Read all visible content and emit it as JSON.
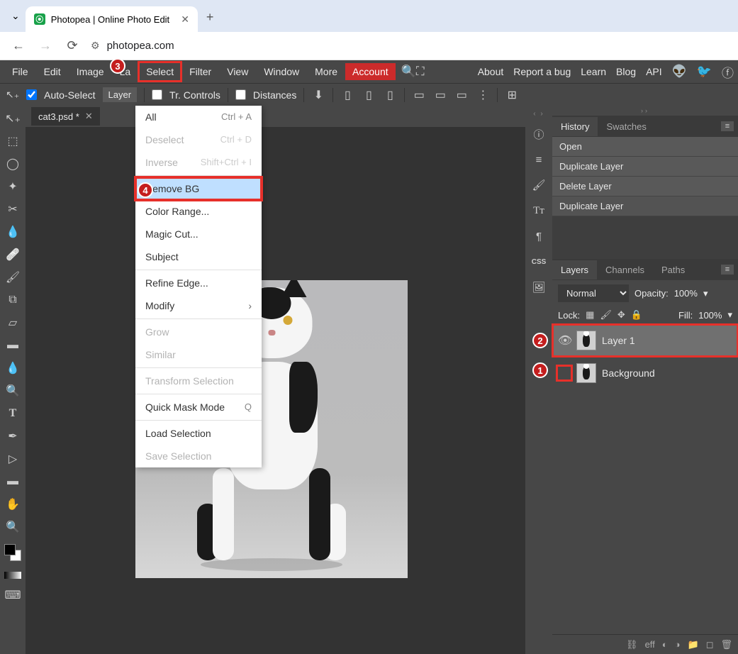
{
  "browser": {
    "tab_title": "Photopea | Online Photo Edit",
    "url": "photopea.com"
  },
  "menubar": {
    "items": [
      "File",
      "Edit",
      "Image",
      "La",
      "Select",
      "Filter",
      "View",
      "Window",
      "More"
    ],
    "account": "Account",
    "right_links": [
      "About",
      "Report a bug",
      "Learn",
      "Blog",
      "API"
    ]
  },
  "options_bar": {
    "auto_select": "Auto-Select",
    "layer_select_value": "Layer",
    "tr_controls": "Tr. Controls",
    "distances": "Distances"
  },
  "file_tab": {
    "name": "cat3.psd *"
  },
  "dropdown": {
    "items": [
      {
        "label": "All",
        "shortcut": "Ctrl + A",
        "disabled": false,
        "sep": false
      },
      {
        "label": "Deselect",
        "shortcut": "Ctrl + D",
        "disabled": true,
        "sep": false
      },
      {
        "label": "Inverse",
        "shortcut": "Shift+Ctrl + I",
        "disabled": true,
        "sep": true
      },
      {
        "label": "Remove BG",
        "shortcut": "",
        "disabled": false,
        "highlighted": true,
        "sep": false
      },
      {
        "label": "Color Range...",
        "shortcut": "",
        "disabled": false,
        "sep": false
      },
      {
        "label": "Magic Cut...",
        "shortcut": "",
        "disabled": false,
        "sep": false
      },
      {
        "label": "Subject",
        "shortcut": "",
        "disabled": false,
        "sep": true
      },
      {
        "label": "Refine Edge...",
        "shortcut": "",
        "disabled": false,
        "sep": false
      },
      {
        "label": "Modify",
        "shortcut": "",
        "disabled": false,
        "arrow": true,
        "sep": true
      },
      {
        "label": "Grow",
        "shortcut": "",
        "disabled": true,
        "sep": false
      },
      {
        "label": "Similar",
        "shortcut": "",
        "disabled": true,
        "sep": true
      },
      {
        "label": "Transform Selection",
        "shortcut": "",
        "disabled": true,
        "sep": true
      },
      {
        "label": "Quick Mask Mode",
        "shortcut": "Q",
        "disabled": false,
        "sep": true
      },
      {
        "label": "Load Selection",
        "shortcut": "",
        "disabled": false,
        "sep": false
      },
      {
        "label": "Save Selection",
        "shortcut": "",
        "disabled": true,
        "sep": false
      }
    ]
  },
  "history_panel": {
    "tabs": [
      "History",
      "Swatches"
    ],
    "items": [
      "Open",
      "Duplicate Layer",
      "Delete Layer",
      "Duplicate Layer"
    ]
  },
  "layers_panel": {
    "tabs": [
      "Layers",
      "Channels",
      "Paths"
    ],
    "blend_mode": "Normal",
    "opacity_label": "Opacity:",
    "opacity_value": "100%",
    "lock_label": "Lock:",
    "fill_label": "Fill:",
    "fill_value": "100%",
    "layers": [
      {
        "name": "Layer 1",
        "visible": true,
        "selected": true
      },
      {
        "name": "Background",
        "visible": false,
        "selected": false
      }
    ],
    "bottom_eff": "eff"
  },
  "annotations": {
    "n1": "1",
    "n2": "2",
    "n3": "3",
    "n4": "4"
  }
}
